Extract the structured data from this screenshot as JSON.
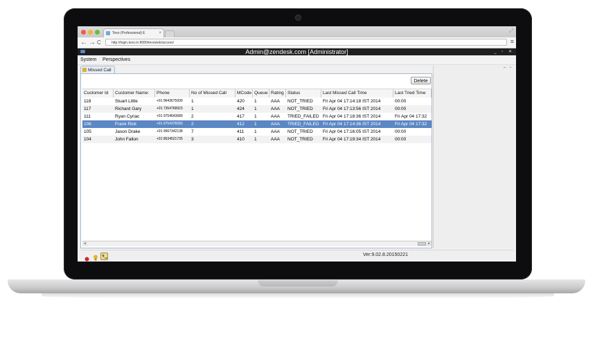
{
  "browser": {
    "tab_title": "Texo (Professional) E",
    "tab_close": "×",
    "url": "http://login.texo.in:8080/texoweb/access/",
    "back": "←",
    "forward": "→",
    "reload": "C",
    "menu_glyph": "≡",
    "resize_glyph": "⤢"
  },
  "app": {
    "title": "Admin@zendesk.com [Administrator]",
    "window_controls": "_ ▫ ✕"
  },
  "menubar": {
    "items": [
      "System",
      "Perspectives"
    ]
  },
  "view": {
    "tab_label": "Missed Call",
    "delete_label": "Delete",
    "view_controls": "‒ ▫"
  },
  "table": {
    "columns": [
      "Customer Id",
      "Customer Name:",
      "Phone",
      "No of Missed Call",
      "MCode",
      "Queue",
      "Rating",
      "Status",
      "Last Missed Call Time",
      "Last Tried Time"
    ],
    "rows": [
      [
        "118",
        "Stuart Little",
        "+91 9643675939",
        "1",
        "420",
        "1",
        "AAA",
        "NOT_TRIED",
        "Fri Apr 04 17:14:18 IST 2014",
        "00:00"
      ],
      [
        "117",
        "Richard Gary",
        "+91 7354768923",
        "1",
        "424",
        "1",
        "AAA",
        "NOT_TRIED",
        "Fri Apr 04 17:13:56 IST 2014",
        "00:00"
      ],
      [
        "111",
        "Ryan Cyriac",
        "+91 9754643689",
        "2",
        "417",
        "1",
        "AAA",
        "TRIED_FAILED",
        "Fri Apr 04 17:18:36 IST 2014",
        "Fri Apr 04 17:32"
      ],
      [
        "106",
        "Frank Rick",
        "+91 9754378283",
        "2",
        "412",
        "1",
        "AAA",
        "TRIED_FAILED",
        "Fri Apr 04 17:14:36 IST 2014",
        "Fri Apr 04 17:32"
      ],
      [
        "105",
        "Jason Drake",
        "+91 9567342138",
        "7",
        "411",
        "1",
        "AAA",
        "NOT_TRIED",
        "Fri Apr 04 17:16:05 IST 2014",
        "00:00"
      ],
      [
        "104",
        "John Fallon",
        "+91 8634521735",
        "3",
        "410",
        "1",
        "AAA",
        "NOT_TRIED",
        "Fri Apr 04 17:19:34 IST 2014",
        "00:00"
      ]
    ],
    "selected_row": 3
  },
  "statusbar": {
    "version": "Ver:9.02.8.20150221"
  },
  "colors": {
    "selection": "#5b87c4",
    "titlebar": "#1f1f1f",
    "status_red": "#d32424",
    "status_yellow": "#e6b422"
  },
  "icons": [
    "record-icon",
    "lightbulb-icon",
    "phone-icon"
  ]
}
